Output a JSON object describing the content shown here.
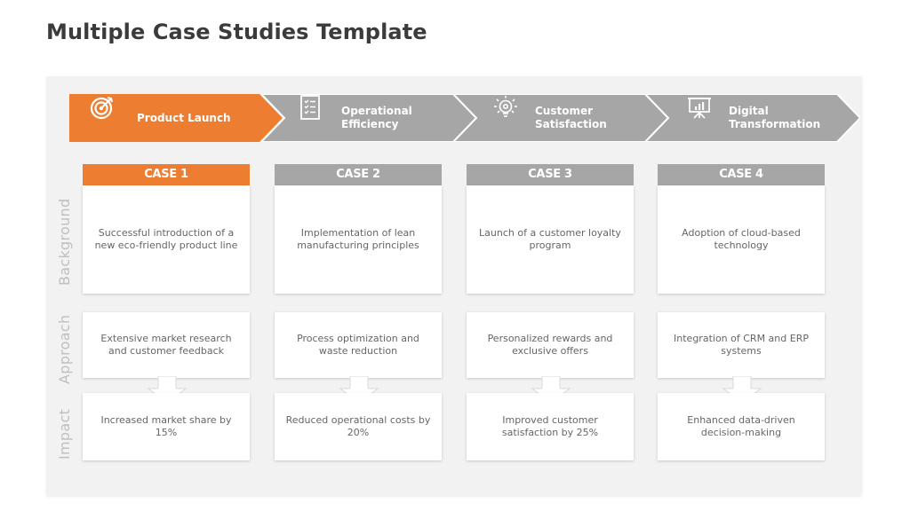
{
  "title": "Multiple Case Studies Template",
  "colors": {
    "accent": "#ED7D31",
    "neutral": "#A6A6A6",
    "panel": "#F2F2F2"
  },
  "stages": [
    {
      "label": "Product Launch",
      "icon": "target-icon",
      "active": true
    },
    {
      "label": "Operational\nEfficiency",
      "icon": "checklist-icon",
      "active": false
    },
    {
      "label": "Customer\nSatisfaction",
      "icon": "lightbulb-icon",
      "active": false
    },
    {
      "label": "Digital\nTransformation",
      "icon": "presentation-chart-icon",
      "active": false
    }
  ],
  "row_labels": {
    "background": "Background",
    "approach": "Approach",
    "impact": "Impact"
  },
  "cases": [
    {
      "header": "CASE 1",
      "active": true,
      "background": "Successful introduction of a new eco-friendly product line",
      "approach": "Extensive market research and customer feedback",
      "impact": "Increased market share by 15%"
    },
    {
      "header": "CASE 2",
      "active": false,
      "background": "Implementation of lean manufacturing principles",
      "approach": "Process optimization and waste reduction",
      "impact": "Reduced operational costs by 20%"
    },
    {
      "header": "CASE 3",
      "active": false,
      "background": "Launch of a customer loyalty program",
      "approach": "Personalized rewards and exclusive offers",
      "impact": "Improved customer satisfaction by 25%"
    },
    {
      "header": "CASE 4",
      "active": false,
      "background": "Adoption of cloud-based technology",
      "approach": "Integration of CRM and ERP systems",
      "impact": "Enhanced data-driven decision-making"
    }
  ]
}
